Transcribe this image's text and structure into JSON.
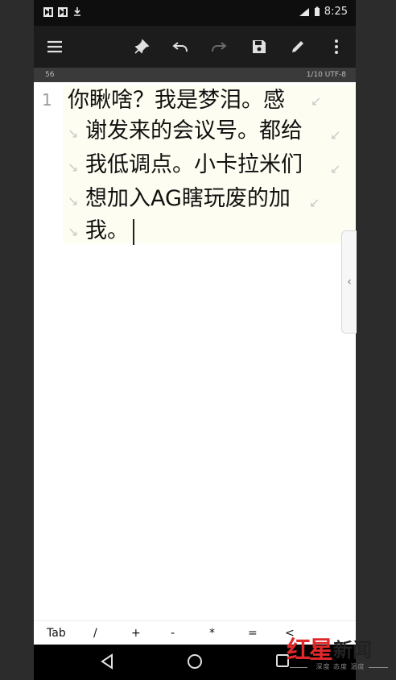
{
  "status_bar": {
    "time": "8:25",
    "icons": [
      "notification-icon",
      "notification-icon",
      "download-icon",
      "signal-icon",
      "battery-icon"
    ]
  },
  "toolbar": {
    "menu": "menu-icon",
    "pin": "pin-icon",
    "undo": "undo-icon",
    "redo": "redo-icon",
    "save": "save-icon",
    "edit": "edit-icon",
    "more": "more-vert-icon"
  },
  "info_bar": {
    "left": "56",
    "right": "1/10 UTF-8"
  },
  "editor": {
    "line_number": "1",
    "visual_lines": [
      "你瞅啥？我是梦泪。感",
      "谢发来的会议号。都给",
      "我低调点。小卡拉米们",
      "想加入AG瞎玩废的加",
      "我。"
    ]
  },
  "side_handle": "‹",
  "extra_keys": [
    "Tab",
    "/",
    "+",
    "-",
    "*",
    "=",
    "<"
  ],
  "watermark": {
    "brand_red": "红星",
    "brand_dark": "新闻",
    "sub": "深度 态度 温度"
  },
  "colors": {
    "app_bar": "#1c1c1c",
    "highlight": "#fdfdf1",
    "watermark_red": "#e0282a"
  }
}
